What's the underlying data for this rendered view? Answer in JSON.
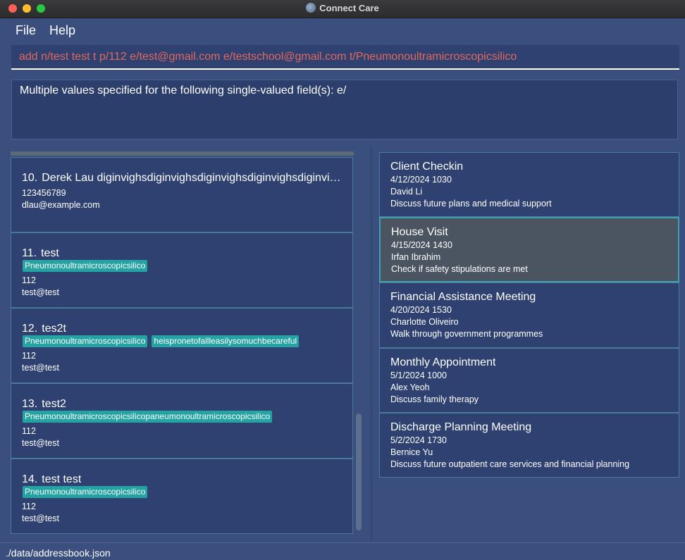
{
  "window": {
    "title": "Connect Care"
  },
  "menu": {
    "file": "File",
    "help": "Help"
  },
  "command": {
    "value": "add n/test test t p/112 e/test@gmail.com  e/testschool@gmail.com t/Pneumonoultramicroscopicsilico"
  },
  "result": {
    "message": "Multiple values specified for the following single-valued field(s): e/"
  },
  "persons": [
    {
      "index": "10.",
      "name": "Derek Lau diginvighsdiginvighsdiginvighsdiginvighsdiginvighsdiginvighsdiginvighs",
      "tags": [],
      "phone": "123456789",
      "email": "dlau@example.com"
    },
    {
      "index": "11.",
      "name": "test",
      "tags": [
        "Pneumonoultramicroscopicsilico"
      ],
      "phone": "112",
      "email": "test@test"
    },
    {
      "index": "12.",
      "name": "tes2t",
      "tags": [
        "Pneumonoultramicroscopicsilico",
        "heispronetofallleasilysomuchbecareful"
      ],
      "phone": "112",
      "email": "test@test"
    },
    {
      "index": "13.",
      "name": "test2",
      "tags": [
        "Pneumonoultramicroscopicsilicopaneumonoultramicroscopicsilico"
      ],
      "phone": "112",
      "email": "test@test"
    },
    {
      "index": "14.",
      "name": "test test",
      "tags": [
        "Pneumonoultramicroscopicsilico"
      ],
      "phone": "112",
      "email": "test@test"
    }
  ],
  "appointments": [
    {
      "title": "Client Checkin",
      "datetime": "4/12/2024 1030",
      "person": "David Li",
      "description": "Discuss future plans and medical support",
      "selected": false
    },
    {
      "title": "House Visit",
      "datetime": "4/15/2024 1430",
      "person": "Irfan Ibrahim",
      "description": "Check if safety stipulations are met",
      "selected": true
    },
    {
      "title": "Financial Assistance Meeting",
      "datetime": "4/20/2024 1530",
      "person": "Charlotte Oliveiro",
      "description": "Walk through government programmes",
      "selected": false
    },
    {
      "title": "Monthly Appointment",
      "datetime": "5/1/2024 1000",
      "person": "Alex Yeoh",
      "description": "Discuss family therapy",
      "selected": false
    },
    {
      "title": "Discharge Planning Meeting",
      "datetime": "5/2/2024 1730",
      "person": "Bernice Yu",
      "description": "Discuss future outpatient care services and financial planning",
      "selected": false
    }
  ],
  "status": {
    "path": "./data/addressbook.json"
  },
  "colors": {
    "background": "#3b4f7e",
    "card": "#2f4170",
    "tag": "#25a3a3",
    "command_text": "#e0685e",
    "selected_card": "#4b5561"
  }
}
